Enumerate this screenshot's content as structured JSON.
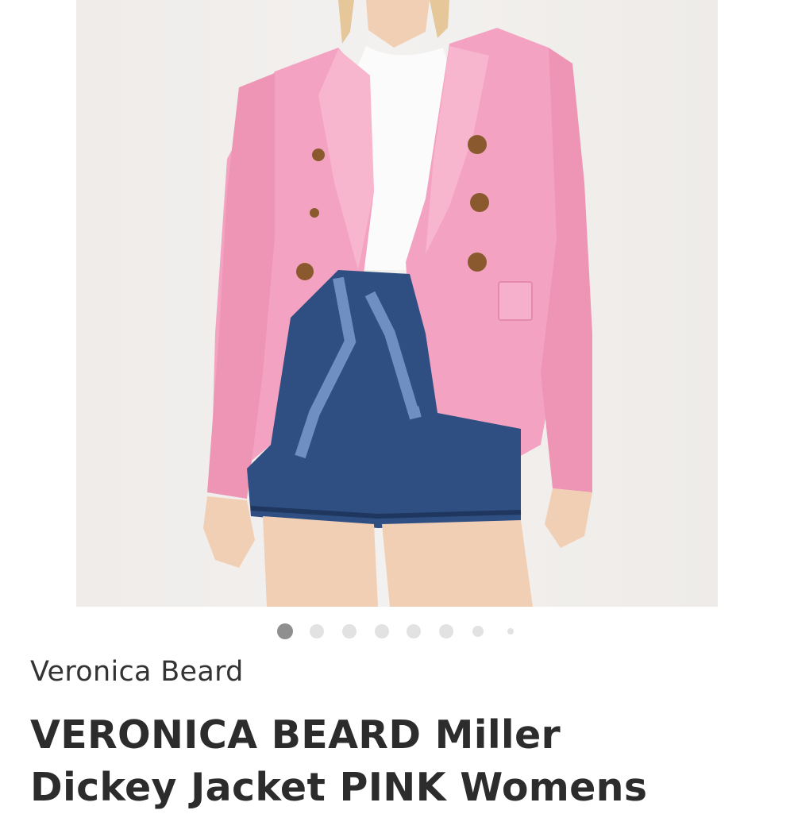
{
  "listing": {
    "image_alt": "Model wearing a pink double-breasted blazer with white top and denim paper-bag shorts",
    "carousel": {
      "total": 8,
      "active_index": 0
    },
    "brand": "Veronica Beard",
    "title_line_1": "VERONICA BEARD Miller",
    "title_line_2": "Dickey Jacket PINK Womens"
  },
  "colors": {
    "jacket": "#f3a3c1",
    "denim": "#2f4f83",
    "active_dot": "#8f8f8f",
    "inactive_dot": "#e2e2e2",
    "text": "#2c2c2c"
  }
}
